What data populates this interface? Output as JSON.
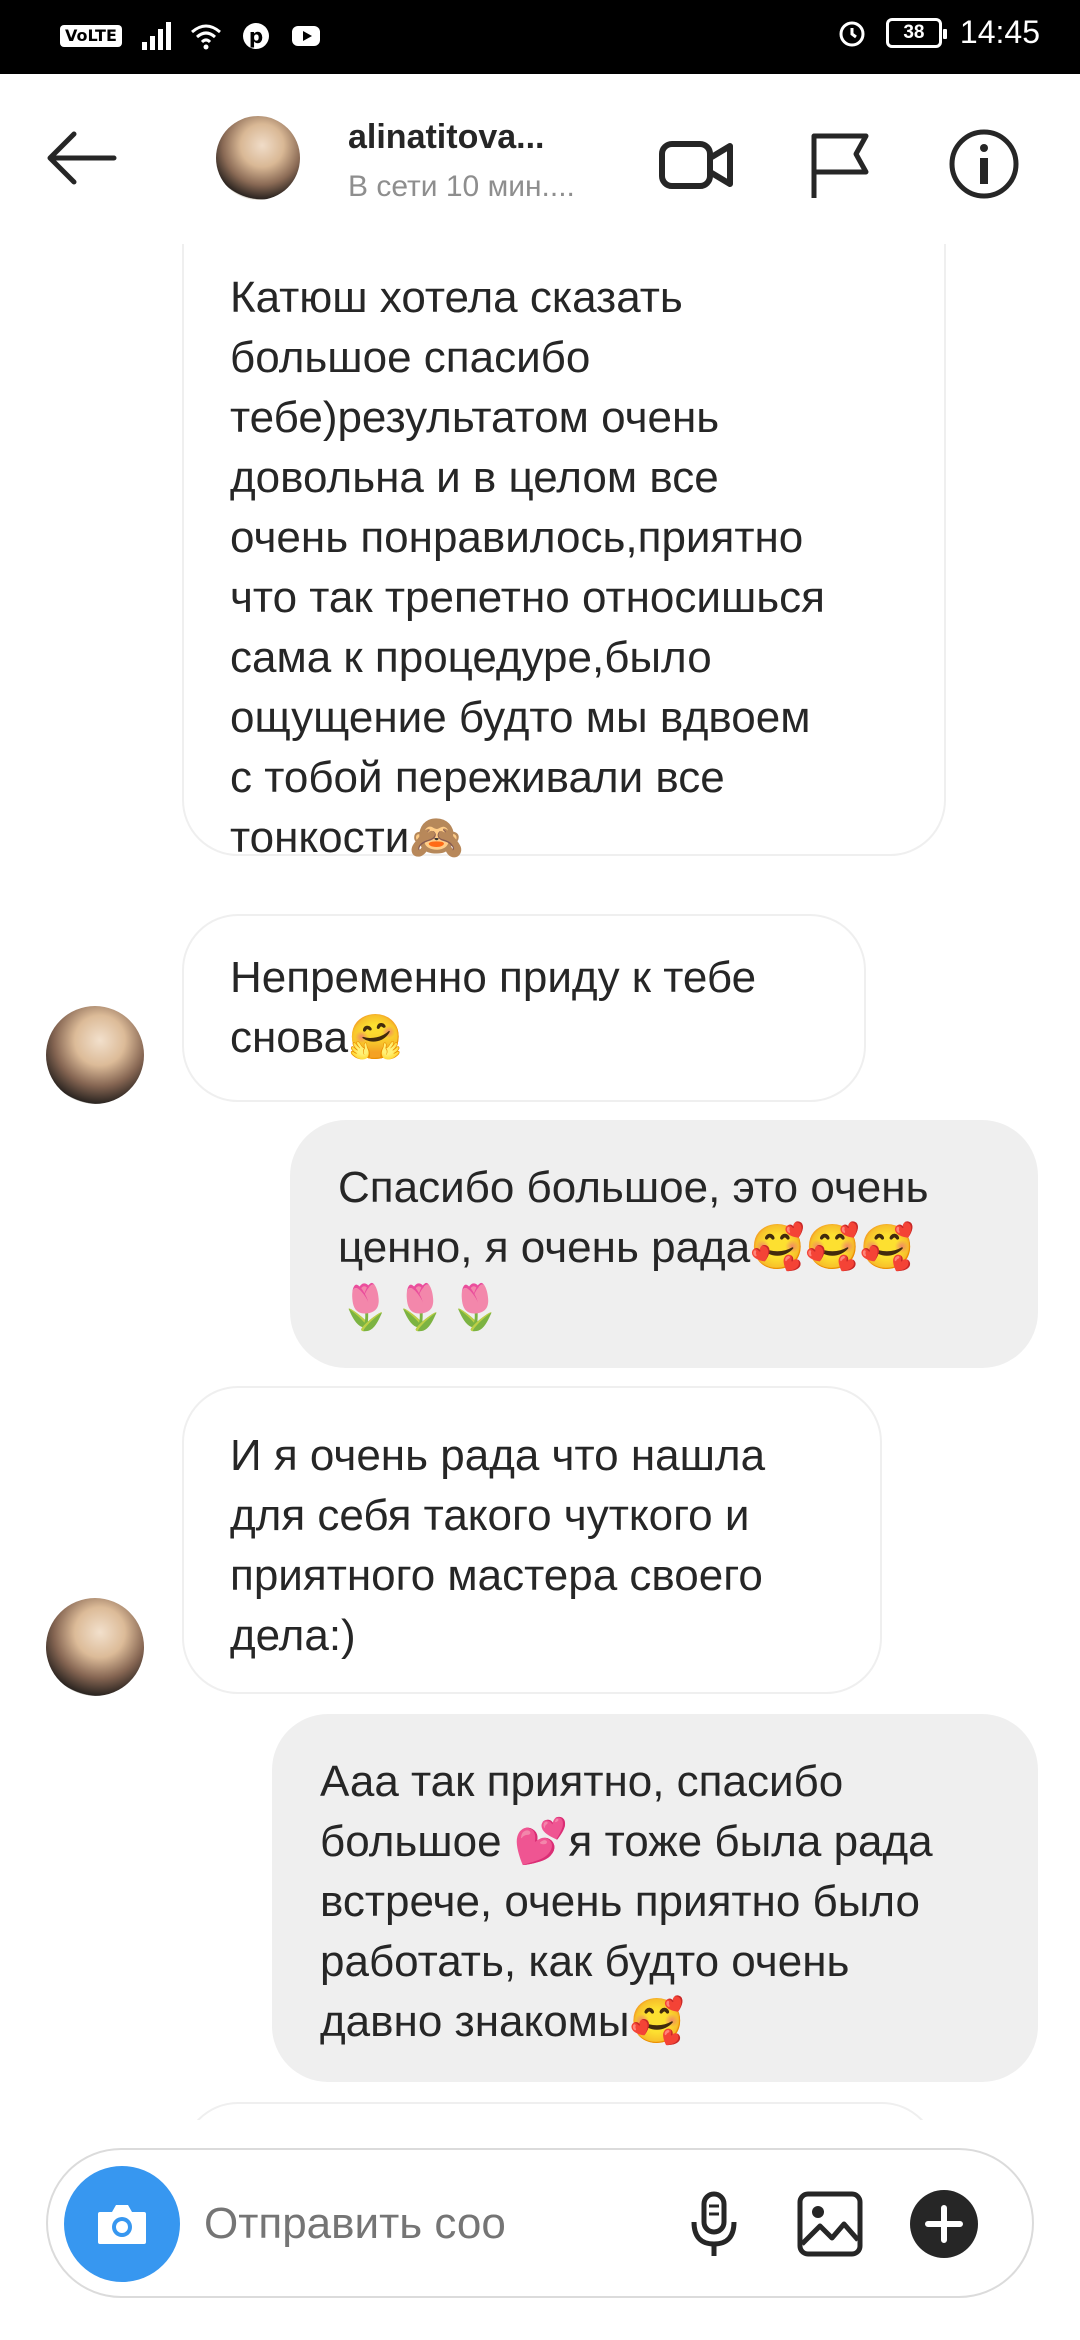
{
  "status_bar": {
    "volte": "VoLTE",
    "battery": "38",
    "time": "14:45"
  },
  "header": {
    "username": "alinatitova...",
    "status": "В сети 10 мин....",
    "icons": [
      "back-arrow-icon",
      "video-call-icon",
      "flag-icon",
      "info-icon"
    ]
  },
  "messages": [
    {
      "direction": "incoming",
      "text": "Катюш хотела сказать\nбольшое спасибо\nтебе)результатом очень\nдовольна и в целом все\nочень понравилось,приятно\nчто так трепетно относишься\nсама к процедуре,было\nощущение будто мы вдвоем\nс тобой переживали все\nтонкости🙈"
    },
    {
      "direction": "incoming",
      "text": "Непременно приду к тебе\nснова🤗"
    },
    {
      "direction": "outgoing",
      "text": "Спасибо большое, это очень\nценно, я очень рада🥰🥰🥰\n🌷🌷🌷"
    },
    {
      "direction": "incoming",
      "text": "И я очень рада что нашла\nдля себя такого чуткого и\nприятного мастера своего\nдела:)"
    },
    {
      "direction": "outgoing",
      "text": "Ааа так приятно, спасибо\nбольшое 💕я тоже была рада\nвстрече, очень приятно было\nработать, как будто очень\nдавно знакомы🥰"
    }
  ],
  "composer": {
    "placeholder": "Отправить сообщ...",
    "accent_color": "#3797f0"
  }
}
